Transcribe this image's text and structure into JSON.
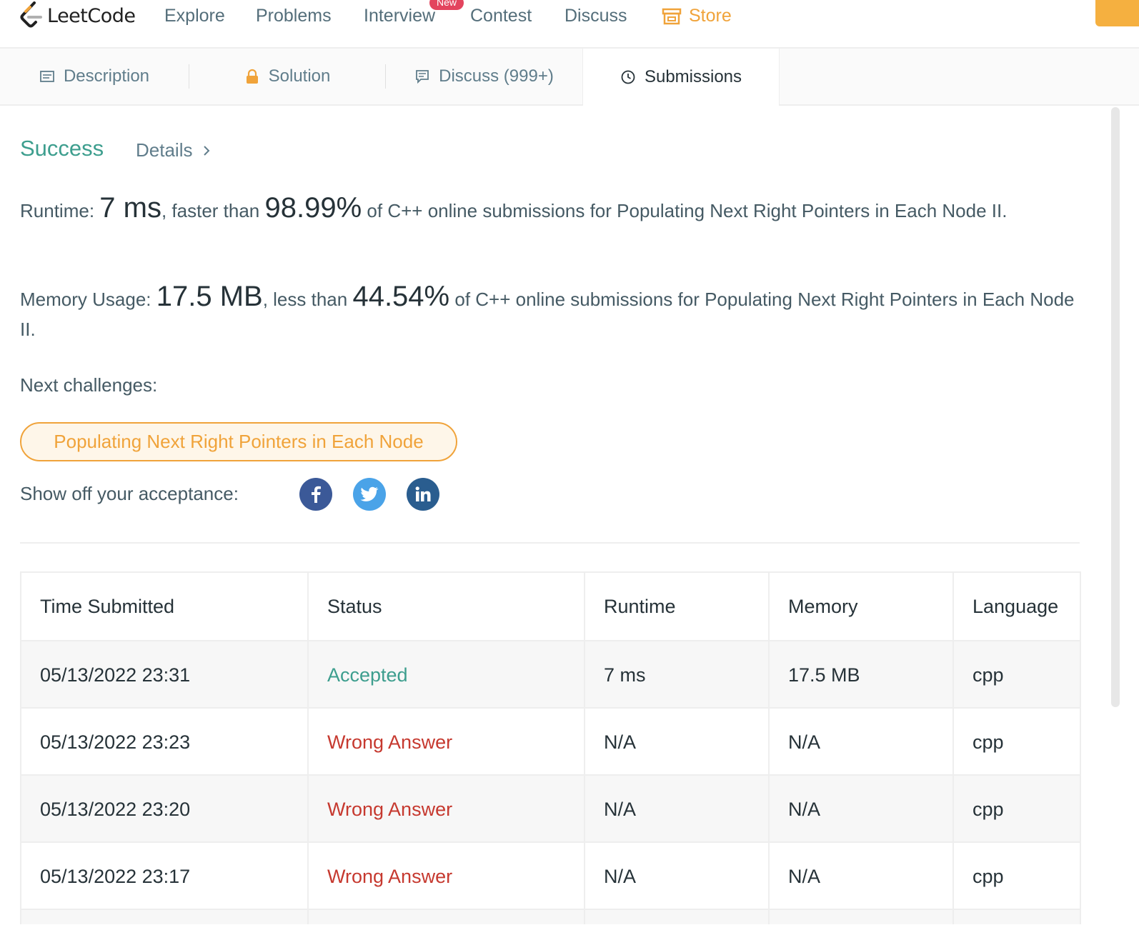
{
  "nav": {
    "logo_text": "LeetCode",
    "items": [
      "Explore",
      "Problems",
      "Interview",
      "Contest",
      "Discuss",
      "Store"
    ],
    "new_badge": "New"
  },
  "tabs": [
    {
      "label": "Description",
      "icon": "description-icon"
    },
    {
      "label": "Solution",
      "icon": "lock-icon"
    },
    {
      "label": "Discuss (999+)",
      "icon": "comment-icon"
    },
    {
      "label": "Submissions",
      "icon": "clock-icon"
    }
  ],
  "result": {
    "status": "Success",
    "details_label": "Details",
    "runtime_label": "Runtime:",
    "runtime_value": "7 ms",
    "runtime_faster": ", faster than",
    "runtime_percent": "98.99%",
    "runtime_tail": "of C++ online submissions for Populating Next Right Pointers in Each Node II.",
    "memory_label": "Memory Usage:",
    "memory_value": "17.5 MB",
    "memory_less": ", less than",
    "memory_percent": "44.54%",
    "memory_tail": "of C++ online submissions for Populating Next Right Pointers in Each Node II.",
    "next_label": "Next challenges:",
    "next_challenge": "Populating Next Right Pointers in Each Node",
    "share_label": "Show off your acceptance:"
  },
  "table": {
    "headers": [
      "Time Submitted",
      "Status",
      "Runtime",
      "Memory",
      "Language"
    ],
    "rows": [
      {
        "time": "05/13/2022 23:31",
        "status": "Accepted",
        "runtime": "7 ms",
        "memory": "17.5 MB",
        "lang": "cpp"
      },
      {
        "time": "05/13/2022 23:23",
        "status": "Wrong Answer",
        "runtime": "N/A",
        "memory": "N/A",
        "lang": "cpp"
      },
      {
        "time": "05/13/2022 23:20",
        "status": "Wrong Answer",
        "runtime": "N/A",
        "memory": "N/A",
        "lang": "cpp"
      },
      {
        "time": "05/13/2022 23:17",
        "status": "Wrong Answer",
        "runtime": "N/A",
        "memory": "N/A",
        "lang": "cpp"
      }
    ]
  },
  "colors": {
    "accent": "#f0a33a",
    "success": "#3d9e8e",
    "error": "#c6392f"
  }
}
